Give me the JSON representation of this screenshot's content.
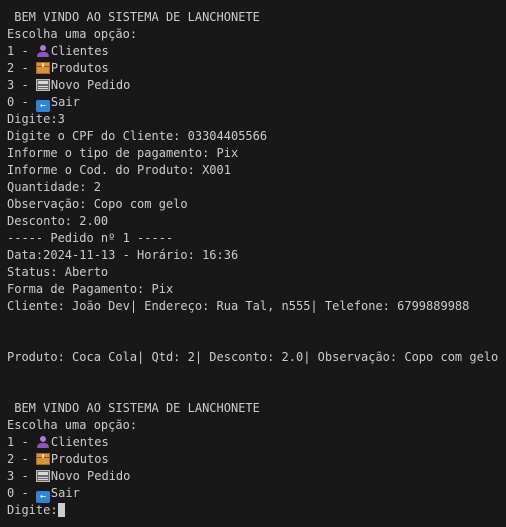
{
  "session1": {
    "title": " BEM VINDO AO SISTEMA DE LANCHONETE",
    "prompt": "Escolha uma opção:",
    "menu": [
      {
        "prefix": "1 - ",
        "label": "Clientes",
        "icon": "person-icon"
      },
      {
        "prefix": "2 - ",
        "label": "Produtos",
        "icon": "package-icon"
      },
      {
        "prefix": "3 - ",
        "label": "Novo Pedido",
        "icon": "cash-register-icon"
      },
      {
        "prefix": "0 - ",
        "label": "Sair",
        "icon": "back-arrow-icon"
      }
    ],
    "lines": [
      "Digite:3",
      "Digite o CPF do Cliente: 03304405566",
      "Informe o tipo de pagamento: Pix",
      "Informe o Cod. do Produto: X001",
      "Quantidade: 2",
      "Observação: Copo com gelo",
      "Desconto: 2.00",
      "----- Pedido nº 1 -----",
      "Data:2024-11-13 - Horário: 16:36",
      "Status: Aberto",
      "Forma de Pagamento: Pix",
      "Cliente: João Dev| Endereço: Rua Tal, n555| Telefone: 6799889988"
    ],
    "product_line": "Produto: Coca Cola| Qtd: 2| Desconto: 2.0| Observação: Copo com gelo"
  },
  "session2": {
    "title": " BEM VINDO AO SISTEMA DE LANCHONETE",
    "prompt": "Escolha uma opção:",
    "menu": [
      {
        "prefix": "1 - ",
        "label": "Clientes",
        "icon": "person-icon"
      },
      {
        "prefix": "2 - ",
        "label": "Produtos",
        "icon": "package-icon"
      },
      {
        "prefix": "3 - ",
        "label": "Novo Pedido",
        "icon": "cash-register-icon"
      },
      {
        "prefix": "0 - ",
        "label": "Sair",
        "icon": "back-arrow-icon"
      }
    ],
    "input_prompt": "Digite:"
  },
  "colors": {
    "background": "#181818",
    "text": "#cccccc"
  }
}
